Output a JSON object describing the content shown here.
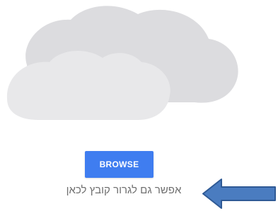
{
  "upload": {
    "browse_label": "BROWSE",
    "drop_hint": "אפשר גם לגרור קובץ לכאן"
  },
  "icons": {
    "cloud": "cloud-icon",
    "arrow": "left-arrow-annotation-icon"
  },
  "colors": {
    "button_bg": "#3f7df0",
    "button_text": "#ffffff",
    "hint_text": "#6f6f6f",
    "cloud_front": "#e8e8ea",
    "cloud_back": "#dcdcdf",
    "arrow_fill": "#4a7cc0",
    "arrow_stroke": "#2f5a95"
  }
}
